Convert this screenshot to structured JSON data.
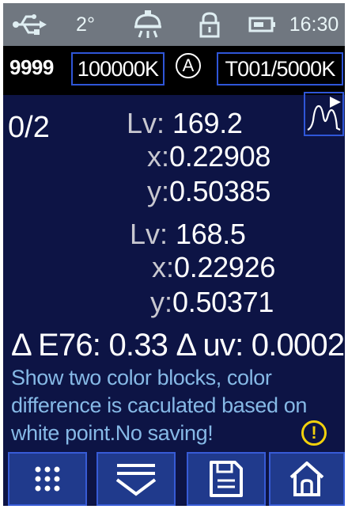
{
  "status_bar": {
    "usb_icon": "usb-icon",
    "angle": "2°",
    "lamp_icon": "lamp-icon",
    "lock_icon": "lock-icon",
    "battery_icon": "battery-icon",
    "time": "16:30"
  },
  "info_bar": {
    "count": "9999",
    "range": "100000K",
    "mode": "A",
    "target": "T001/5000K"
  },
  "measurement": {
    "counter": "0/2",
    "block1": {
      "lv_label": "Lv:",
      "lv_value": "169.2",
      "x_label": "x:",
      "x_value": "0.22908",
      "y_label": "y:",
      "y_value": "0.50385"
    },
    "block2": {
      "lv_label": "Lv:",
      "lv_value": "168.5",
      "x_label": "x:",
      "x_value": "0.22926",
      "y_label": "y:",
      "y_value": "0.50371"
    }
  },
  "difference": {
    "de_label": "Δ E76:",
    "de_value": "0.33",
    "uv_label": "Δ uv:",
    "uv_value": "0.0002"
  },
  "message": "Show two color  blocks, color difference is caculated based on white point.No saving!",
  "toolbar": {
    "items": [
      "menu-grid-icon",
      "dropdown-icon",
      "save-icon",
      "home-icon"
    ]
  },
  "colors": {
    "screen_bg": "#0d1445",
    "status_bg": "#707780",
    "accent_border": "#2f56d8",
    "message_text": "#86b9e6",
    "warning": "#f2d10c",
    "toolbar_button": "#203a8c"
  }
}
